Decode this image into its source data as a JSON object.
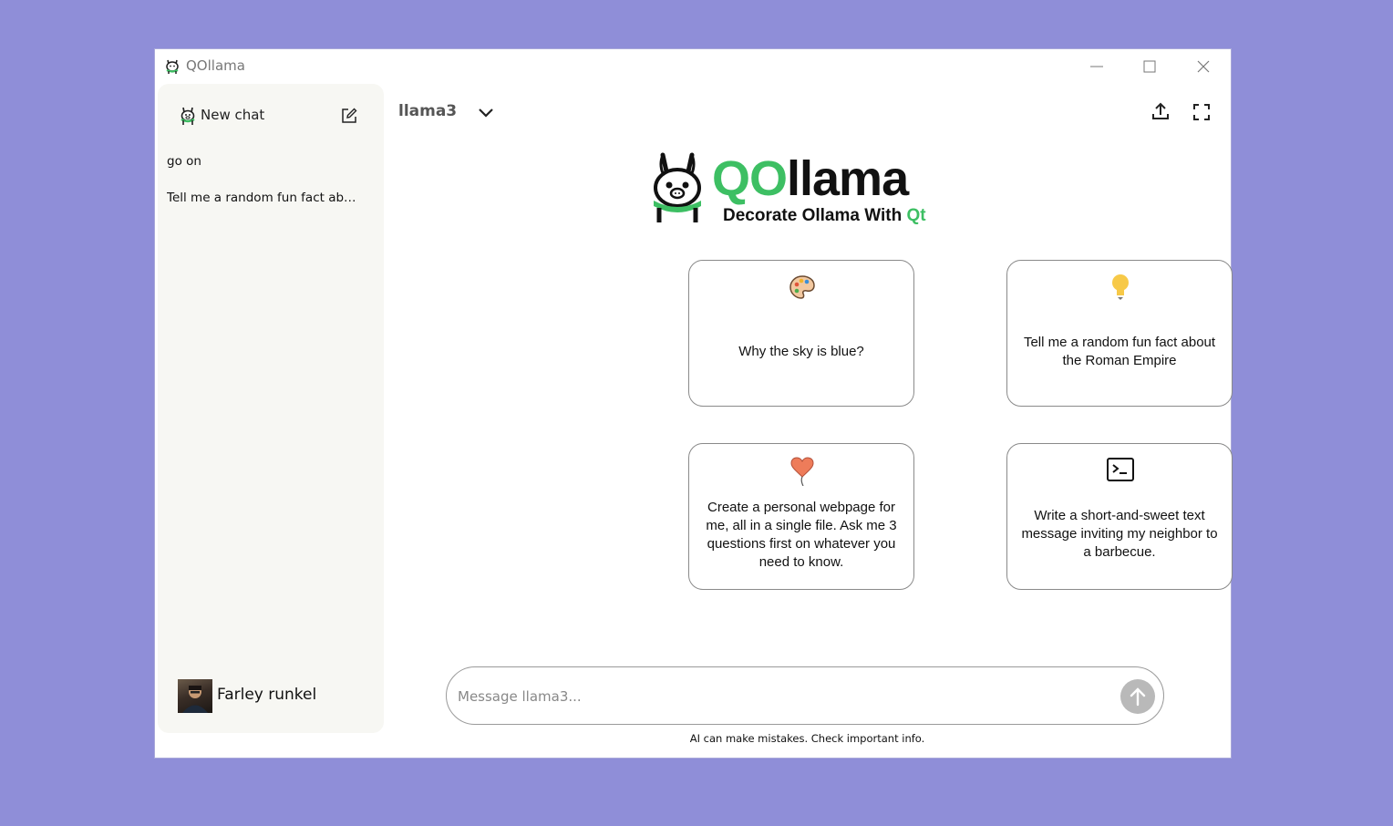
{
  "window": {
    "title": "QOllama",
    "controls": [
      "minimize-icon",
      "maximize-icon",
      "close-icon"
    ]
  },
  "sidebar": {
    "new_chat_label": "New chat",
    "history": [
      {
        "label": "go on"
      },
      {
        "label": "Tell me a random fun fact about the Roman Empire"
      }
    ],
    "user": {
      "name": "Farley runkel"
    }
  },
  "header": {
    "model": "llama3",
    "icons": [
      "chevron-down-icon",
      "share-upload-icon",
      "fullscreen-icon"
    ]
  },
  "logo": {
    "word_q": "QO",
    "word_rest": "llama",
    "tagline": "Decorate Ollama With",
    "tagline_accent": "Qt"
  },
  "suggestions": [
    {
      "icon": "palette-icon",
      "text": "Why the sky is blue?"
    },
    {
      "icon": "lightbulb-icon",
      "text": "Tell me a random fun fact about the Roman Empire"
    },
    {
      "icon": "heart-balloon-icon",
      "text": "Create a personal webpage for me, all in a single file. Ask me 3 questions first on whatever you need to know."
    },
    {
      "icon": "terminal-icon",
      "text": "Write a short-and-sweet text message inviting my neighbor to a barbecue."
    }
  ],
  "composer": {
    "placeholder": "Message llama3...",
    "value": ""
  },
  "disclaimer": "AI can make mistakes. Check important info.",
  "colors": {
    "background": "#8f8ed8",
    "accent_green": "#3dbf63",
    "sidebar_bg": "#f7f7f3",
    "send_button": "#b9b9b9"
  }
}
